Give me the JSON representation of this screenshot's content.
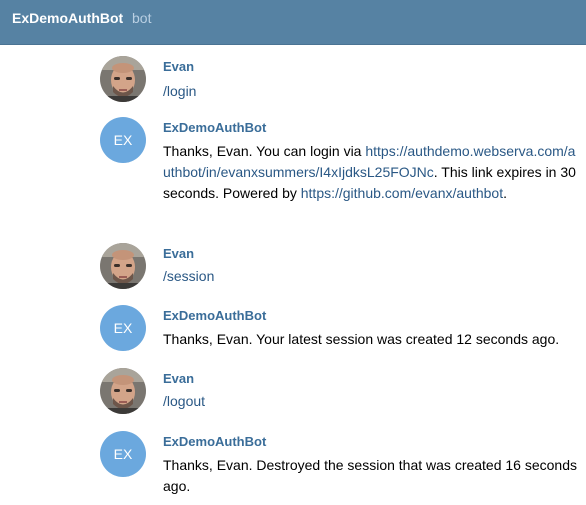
{
  "header": {
    "title": "ExDemoAuthBot",
    "subtitle": "bot"
  },
  "bot_avatar_initials": "EX",
  "messages": [
    {
      "sender": "Evan",
      "text": "/login"
    },
    {
      "sender": "ExDemoAuthBot",
      "text_before": "Thanks, Evan. You can login via ",
      "link1": "https://authdemo.webserva.com/authbot/in/evanxsummers/I4xIjdksL25FOJNc",
      "text_middle": ". This link expires in 30 seconds. Powered by ",
      "link2": "https://github.com/evanx/authbot",
      "text_after": "."
    },
    {
      "sender": "Evan",
      "text": "/session"
    },
    {
      "sender": "ExDemoAuthBot",
      "text": "Thanks, Evan. Your latest session was created 12 seconds ago."
    },
    {
      "sender": "Evan",
      "text": "/logout"
    },
    {
      "sender": "ExDemoAuthBot",
      "text": "Thanks, Evan. Destroyed the session that was created 16 seconds ago."
    }
  ]
}
